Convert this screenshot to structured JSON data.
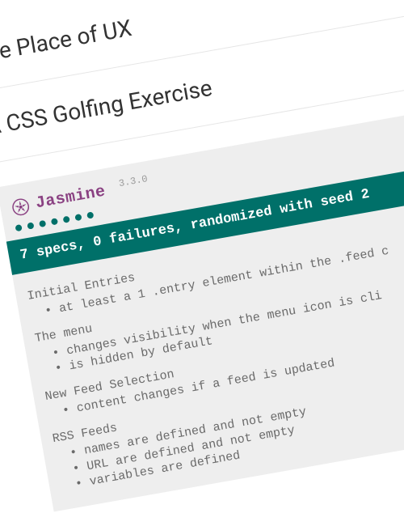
{
  "articles": [
    {
      "title": "The Place of UX"
    },
    {
      "title": "A CSS Golfing Exercise"
    }
  ],
  "jasmine": {
    "brand": "Jasmine",
    "version": "3.3.0",
    "dot_count": 7,
    "status": "7 specs, 0 failures, randomized with seed 2",
    "suites": [
      {
        "name": "Initial Entries",
        "specs": [
          "at least a 1 .entry element within the .feed c"
        ]
      },
      {
        "name": "The menu",
        "specs": [
          "changes visibility when the menu icon is cli",
          "is hidden by default"
        ]
      },
      {
        "name": "New Feed Selection",
        "specs": [
          "content changes if a feed is updated"
        ]
      },
      {
        "name": "RSS Feeds",
        "specs": [
          "names are defined and not empty",
          "URL are defined and not empty",
          "variables are defined"
        ]
      }
    ]
  },
  "colors": {
    "accent": "#007069",
    "brand": "#8a4182",
    "panel_bg": "#eeeeee"
  }
}
